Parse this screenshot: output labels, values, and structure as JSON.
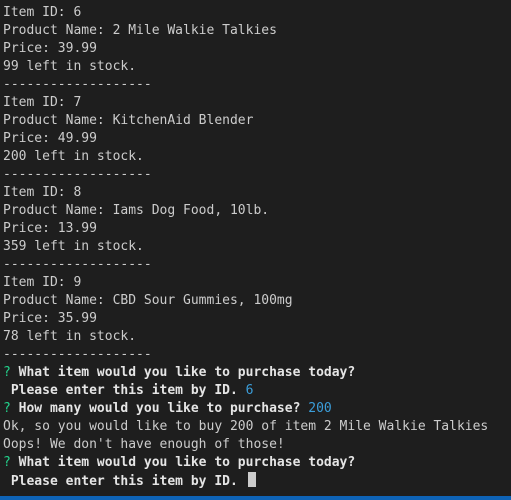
{
  "items": [
    {
      "id_line": "Item ID: 6",
      "name_line": "Product Name: 2 Mile Walkie Talkies",
      "price_line": "Price: 39.99",
      "stock_line": "99 left in stock."
    },
    {
      "id_line": "Item ID: 7",
      "name_line": "Product Name: KitchenAid Blender",
      "price_line": "Price: 49.99",
      "stock_line": "200 left in stock."
    },
    {
      "id_line": "Item ID: 8",
      "name_line": "Product Name: Iams Dog Food, 10lb.",
      "price_line": "Price: 13.99",
      "stock_line": "359 left in stock."
    },
    {
      "id_line": "Item ID: 9",
      "name_line": "Product Name: CBD Sour Gummies, 100mg",
      "price_line": "Price: 35.99",
      "stock_line": "78 left in stock."
    }
  ],
  "separator": "-------------------",
  "session": {
    "q_mark": "?",
    "q1": "What item would you like to purchase today?",
    "q1_sub": " Please enter this item by ID.",
    "a1": "6",
    "q2": "How many would you like to purchase?",
    "a2": "200",
    "msg1": "Ok, so you would like to buy 200 of item 2 Mile Walkie Talkies",
    "msg2": "Oops! We don't have enough of those!",
    "q3": "What item would you like to purchase today?",
    "q3_sub": " Please enter this item by ID."
  },
  "colors": {
    "background": "#1e1e1e",
    "text": "#cccccc",
    "prompt_marker": "#23d18b",
    "answer": "#3b9eda",
    "status_bar": "#0e63b6"
  }
}
